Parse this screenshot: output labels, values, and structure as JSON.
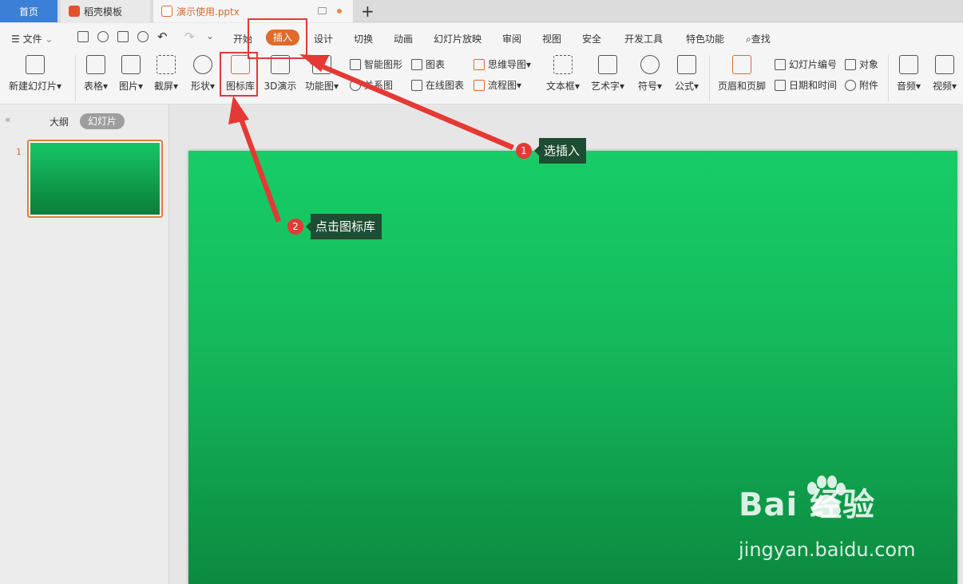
{
  "tabs": {
    "home": "首页",
    "template": "稻壳模板",
    "document": "演示使用.pptx"
  },
  "menu": {
    "file": "文件",
    "items": [
      "开始",
      "插入",
      "设计",
      "切换",
      "动画",
      "幻灯片放映",
      "审阅",
      "视图",
      "安全",
      "开发工具",
      "特色功能"
    ],
    "search": "查找"
  },
  "ribbon": {
    "new_slide": "新建幻灯片",
    "table": "表格",
    "picture": "图片",
    "screenshot": "截屏",
    "shape": "形状",
    "icon_library": "图标库",
    "demo_3d": "3D演示",
    "function_chart": "功能图",
    "smart_art": "智能图形",
    "relation": "关系图",
    "chart": "图表",
    "online_chart": "在线图表",
    "mind_map": "思维导图",
    "flowchart": "流程图",
    "text_box": "文本框",
    "word_art": "艺术字",
    "symbol": "符号",
    "formula": "公式",
    "header_footer": "页眉和页脚",
    "slide_number": "幻灯片编号",
    "date_time": "日期和时间",
    "object": "对象",
    "attachment": "附件",
    "audio": "音频",
    "video": "视频"
  },
  "left_panel": {
    "outline_tab": "大纲",
    "slides_tab": "幻灯片",
    "slide_number": "1"
  },
  "annotations": {
    "step1_num": "1",
    "step1_text": "选插入",
    "step2_num": "2",
    "step2_text": "点击图标库"
  },
  "watermark": {
    "brand": "Bai  经验",
    "url": "jingyan.baidu.com"
  },
  "colors": {
    "accent": "#e06a2c",
    "annotation_red": "#e53935",
    "slide_green": "#17cd67"
  }
}
